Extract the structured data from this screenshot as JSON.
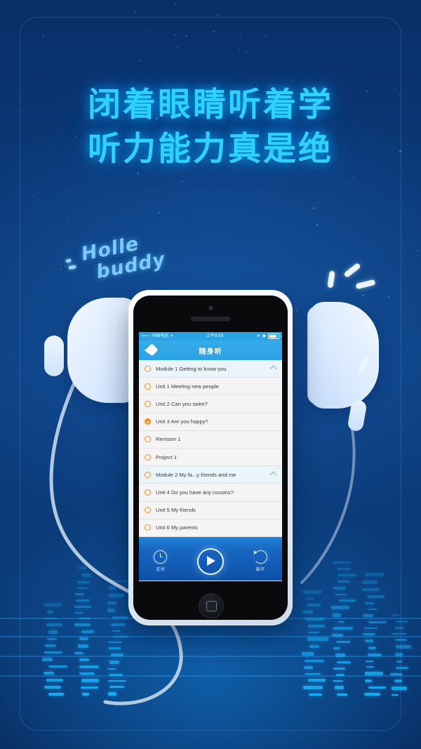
{
  "poster": {
    "headline_line1": "闭着眼睛听着学",
    "headline_line2": "听力能力真是绝",
    "sticker_line1": "Holle",
    "sticker_line2": "buddy",
    "accent_color": "#2fd2ff",
    "background_color": "#0b3876"
  },
  "phone": {
    "status_bar": {
      "signal_dots": "•••••",
      "carrier": "中国电信",
      "wifi_icon": "wifi-icon",
      "time": "上午9:53",
      "location_icon": "location-icon",
      "lock_icon": "rotation-lock-icon",
      "battery_icon": "battery-icon"
    },
    "nav_bar": {
      "back_icon": "back-arrow-icon",
      "title": "随身听"
    },
    "list": [
      {
        "label": "Module 1  Getting to know you",
        "type": "module",
        "state": "pending",
        "expanded": true
      },
      {
        "label": "Unit 1  Meeting new people",
        "type": "unit",
        "state": "pending"
      },
      {
        "label": "Unit 2  Can you swim?",
        "type": "unit",
        "state": "pending"
      },
      {
        "label": "Unit 3  Are you happy?",
        "type": "unit",
        "state": "done"
      },
      {
        "label": "Revision 1",
        "type": "unit",
        "state": "pending"
      },
      {
        "label": "Project 1",
        "type": "unit",
        "state": "pending"
      },
      {
        "label": "Module 2  My fa...y friends and me",
        "type": "module",
        "state": "pending",
        "expanded": true
      },
      {
        "label": "Unit 4  Do you have any cousins?",
        "type": "unit",
        "state": "pending"
      },
      {
        "label": "Unit 5  My friends",
        "type": "unit",
        "state": "pending"
      },
      {
        "label": "Unit 6  My parents",
        "type": "unit",
        "state": "pending"
      }
    ],
    "player": {
      "timer_icon": "clock-icon",
      "timer_label": "定时",
      "play_icon": "play-icon",
      "loop_icon": "loop-icon",
      "loop_label": "循环"
    }
  }
}
